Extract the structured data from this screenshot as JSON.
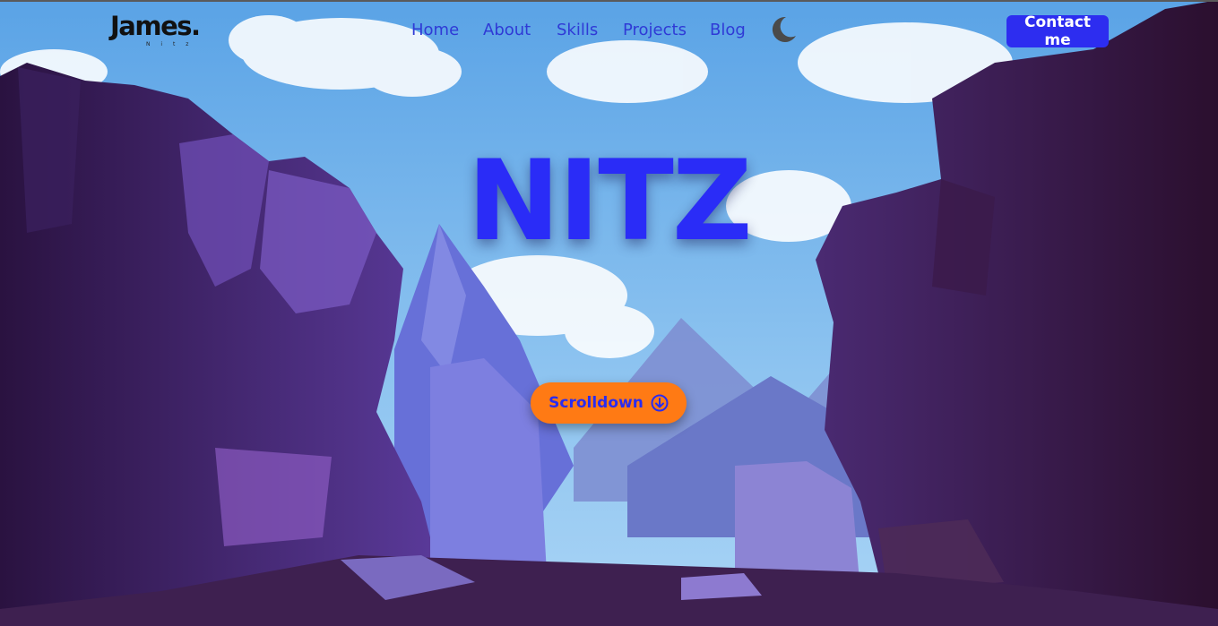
{
  "brand": {
    "name": "James.",
    "tagline": "N i t z"
  },
  "nav": {
    "items": [
      {
        "label": "Home"
      },
      {
        "label": "About"
      },
      {
        "label": "Skills"
      },
      {
        "label": "Projects"
      },
      {
        "label": "Blog"
      }
    ],
    "theme_toggle_icon": "moon-icon"
  },
  "header": {
    "contact_label": "Contact me"
  },
  "hero": {
    "title": "NITZ",
    "scroll_label": "Scrolldown",
    "scroll_icon": "arrow-down-circle-icon"
  },
  "colors": {
    "accent": "#2a2cf7",
    "contact_bg": "#2d2df0",
    "scroll_bg": "#ff7a14",
    "sky": "#6fb0ea"
  }
}
